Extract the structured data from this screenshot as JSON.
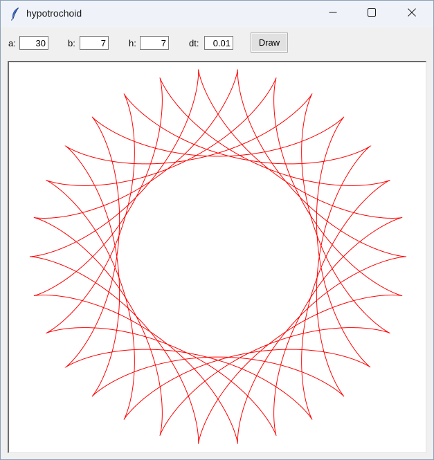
{
  "window": {
    "title": "hypotrochoid",
    "icon": "feather-icon",
    "controls": [
      "minimize-icon",
      "maximize-icon",
      "close-icon"
    ]
  },
  "toolbar": {
    "a_label": "a:",
    "a_value": "30",
    "b_label": "b:",
    "b_value": "7",
    "h_label": "h:",
    "h_value": "7",
    "dt_label": "dt:",
    "dt_value": "0.01",
    "draw_label": "Draw"
  },
  "canvas": {
    "background": "#ffffff",
    "curve_color": "#ff0000"
  }
}
